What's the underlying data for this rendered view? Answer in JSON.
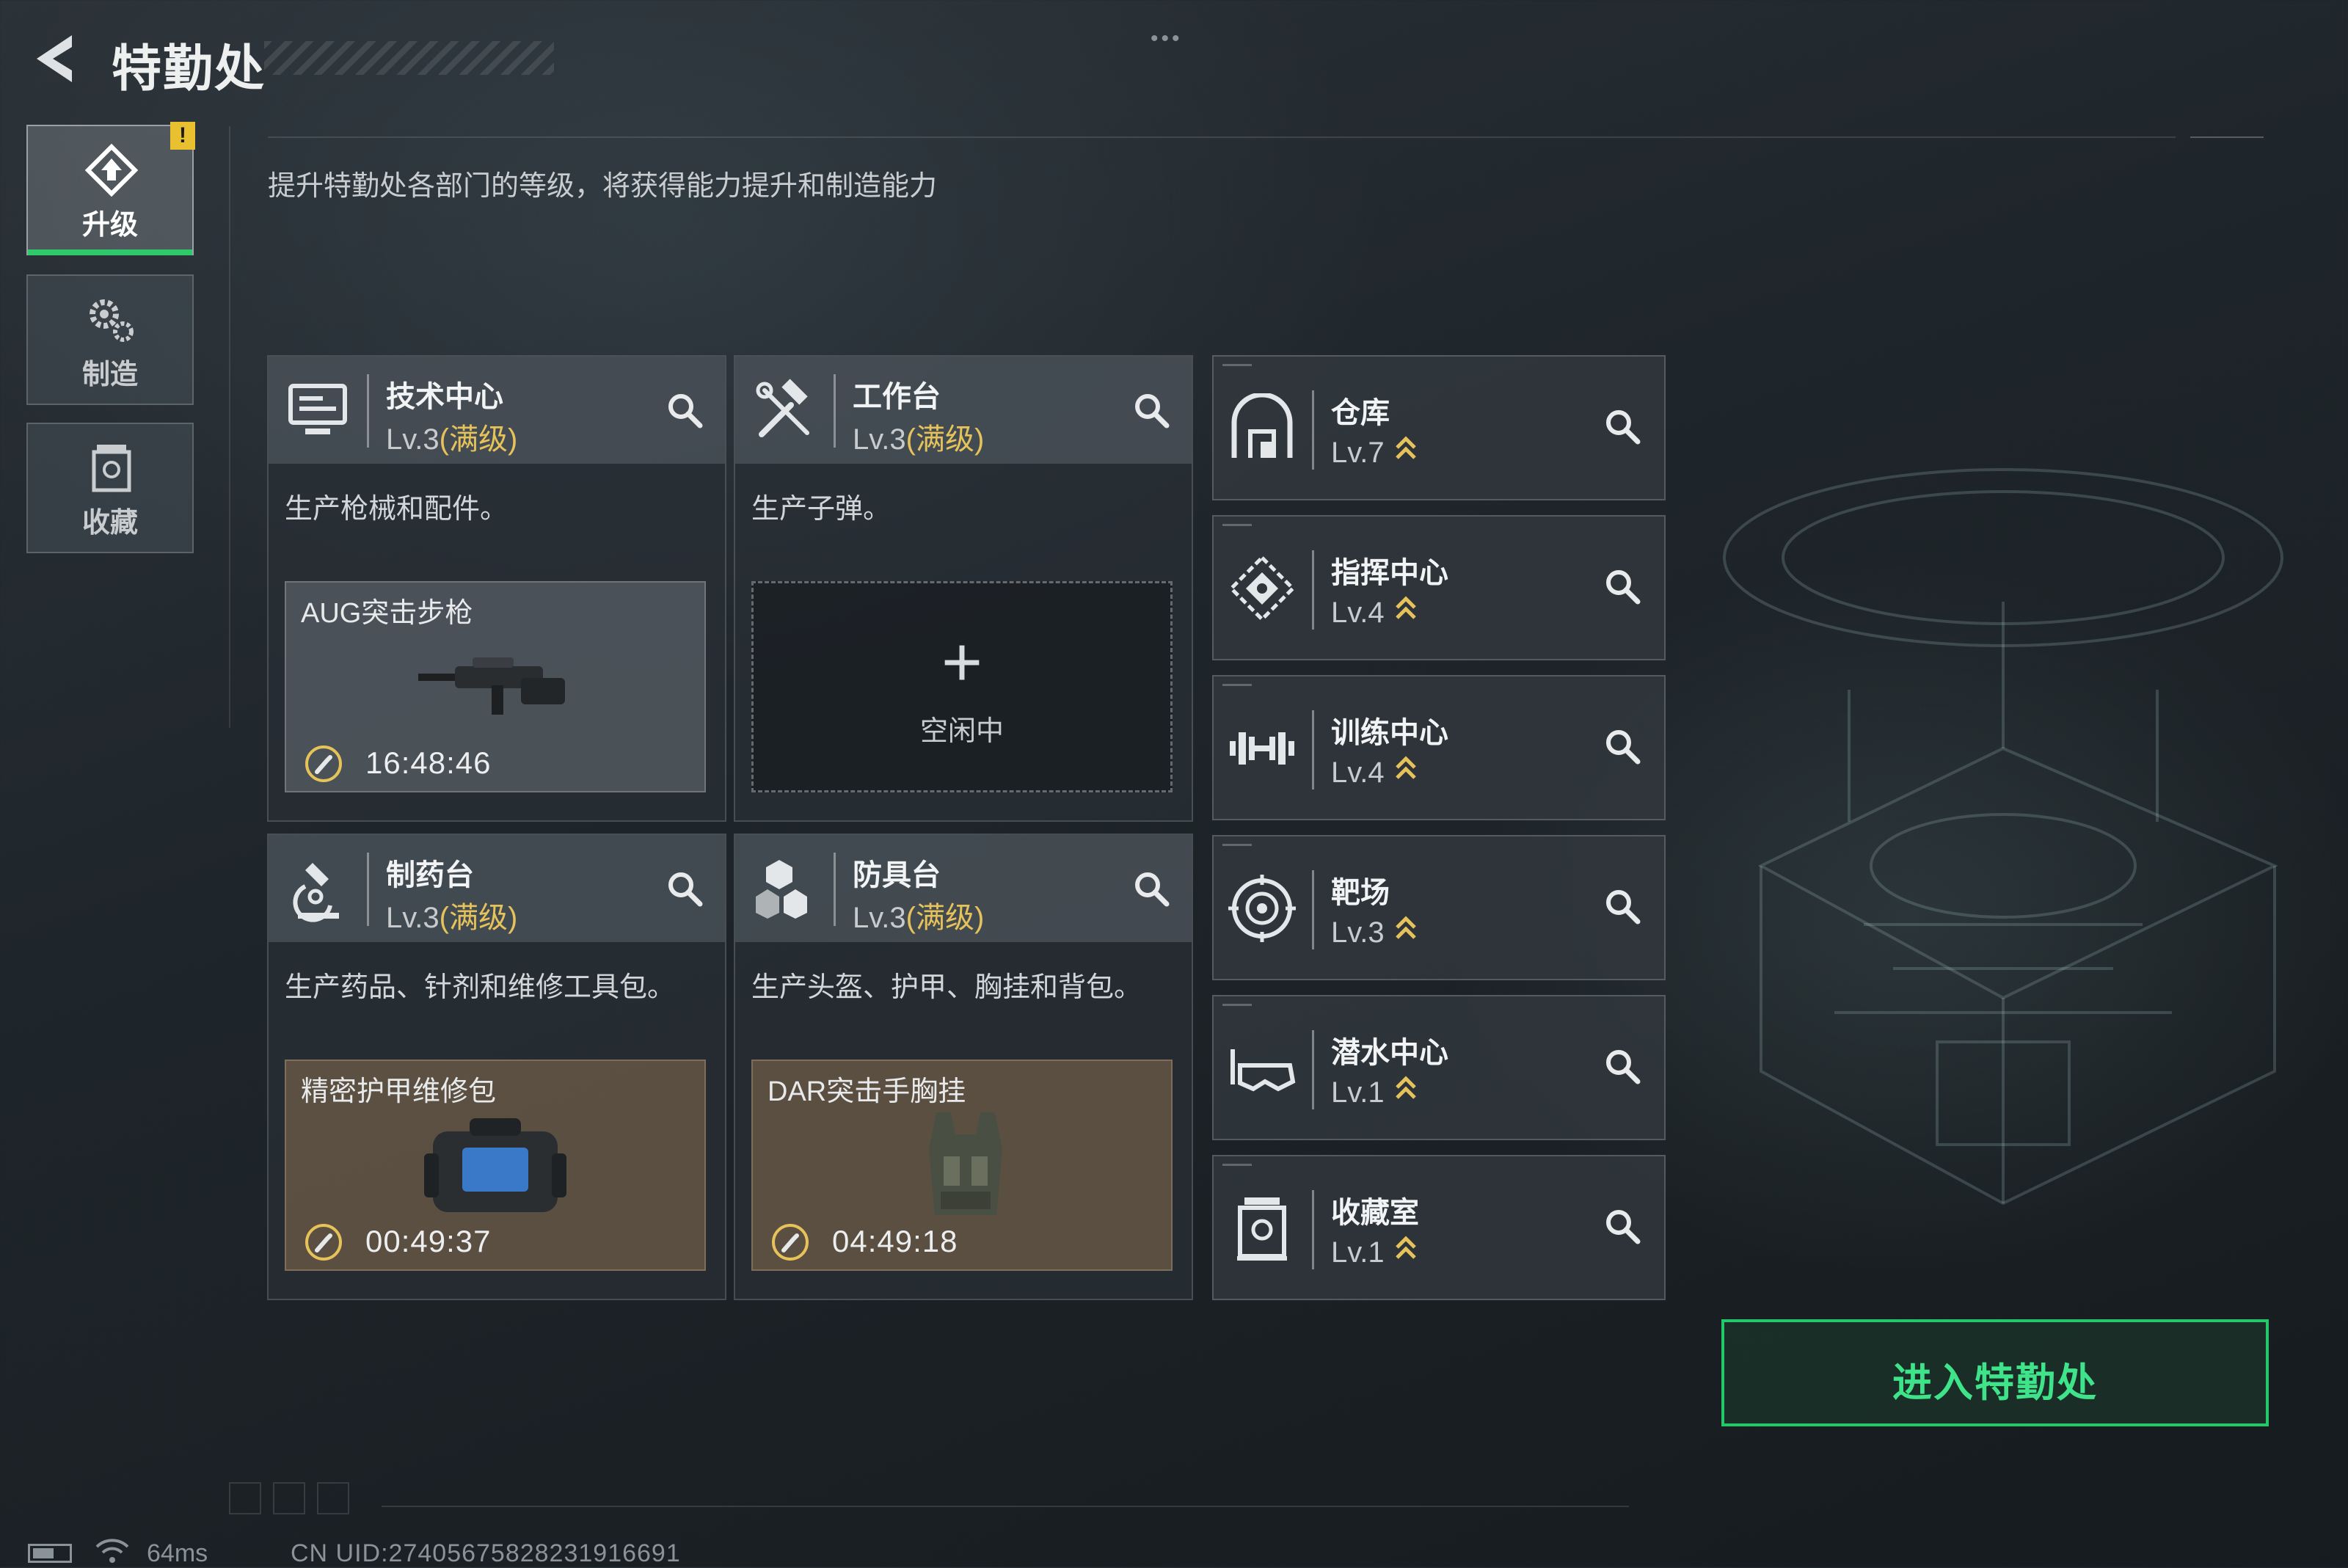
{
  "header": {
    "title": "特勤处",
    "subtitle": "提升特勤处各部门的等级，将获得能力提升和制造能力"
  },
  "nav": {
    "tabs": [
      {
        "label": "升级",
        "icon": "upgrade-icon",
        "active": true,
        "alert": "!"
      },
      {
        "label": "制造",
        "icon": "gears-icon",
        "active": false
      },
      {
        "label": "收藏",
        "icon": "collection-icon",
        "active": false
      }
    ]
  },
  "facilities": [
    {
      "name": "技术中心",
      "level": "Lv.3",
      "max_label": "(满级)",
      "desc": "生产枪械和配件。",
      "production": {
        "item": "AUG突击步枪",
        "timer": "16:48:46",
        "style": "gray",
        "image": "rifle-image"
      }
    },
    {
      "name": "工作台",
      "level": "Lv.3",
      "max_label": "(满级)",
      "desc": "生产子弹。",
      "production": {
        "idle": true,
        "status": "空闲中",
        "plus": "+"
      }
    },
    {
      "name": "制药台",
      "level": "Lv.3",
      "max_label": "(满级)",
      "desc": "生产药品、针剂和维修工具包。",
      "production": {
        "item": "精密护甲维修包",
        "timer": "00:49:37",
        "style": "brown",
        "image": "repair-kit-image"
      }
    },
    {
      "name": "防具台",
      "level": "Lv.3",
      "max_label": "(满级)",
      "desc": "生产头盔、护甲、胸挂和背包。",
      "production": {
        "item": "DAR突击手胸挂",
        "timer": "04:49:18",
        "style": "brown",
        "image": "chest-rig-image"
      }
    }
  ],
  "departments": [
    {
      "name": "仓库",
      "level": "Lv.7",
      "icon": "warehouse-icon"
    },
    {
      "name": "指挥中心",
      "level": "Lv.4",
      "icon": "command-center-icon"
    },
    {
      "name": "训练中心",
      "level": "Lv.4",
      "icon": "dumbbell-icon"
    },
    {
      "name": "靶场",
      "level": "Lv.3",
      "icon": "target-icon"
    },
    {
      "name": "潜水中心",
      "level": "Lv.1",
      "icon": "diving-mask-icon"
    },
    {
      "name": "收藏室",
      "level": "Lv.1",
      "icon": "collection-room-icon"
    }
  ],
  "enter_button": {
    "label": "进入特勤处"
  },
  "status_bar": {
    "ping": "64ms",
    "uid": "CN UID:27405675828231916691"
  },
  "colors": {
    "accent_green": "#2ec96b",
    "max_level_gold": "#e6c25a",
    "alert_yellow": "#e8c030"
  }
}
